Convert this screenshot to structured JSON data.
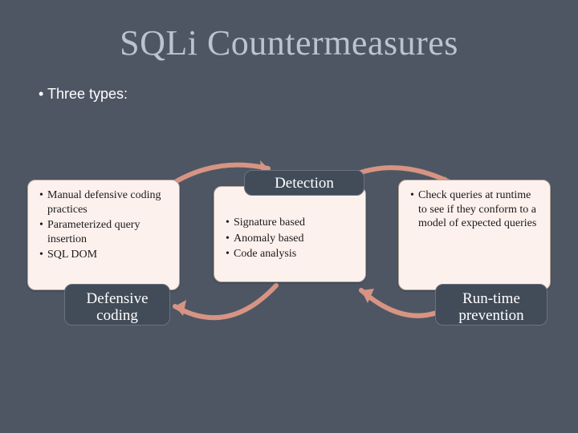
{
  "title": "SQLi Countermeasures",
  "subtitle": "•  Three types:",
  "cards": {
    "c1": {
      "label": "Defensive coding",
      "items": [
        "Manual defensive coding practices",
        "Parameterized query insertion",
        "SQL DOM"
      ]
    },
    "c2": {
      "label": "Detection",
      "items": [
        "Signature based",
        "Anomaly based",
        "Code analysis"
      ]
    },
    "c3": {
      "label": "Run-time prevention",
      "items": [
        "Check queries at runtime to see if they conform to a model of expected queries"
      ]
    }
  }
}
